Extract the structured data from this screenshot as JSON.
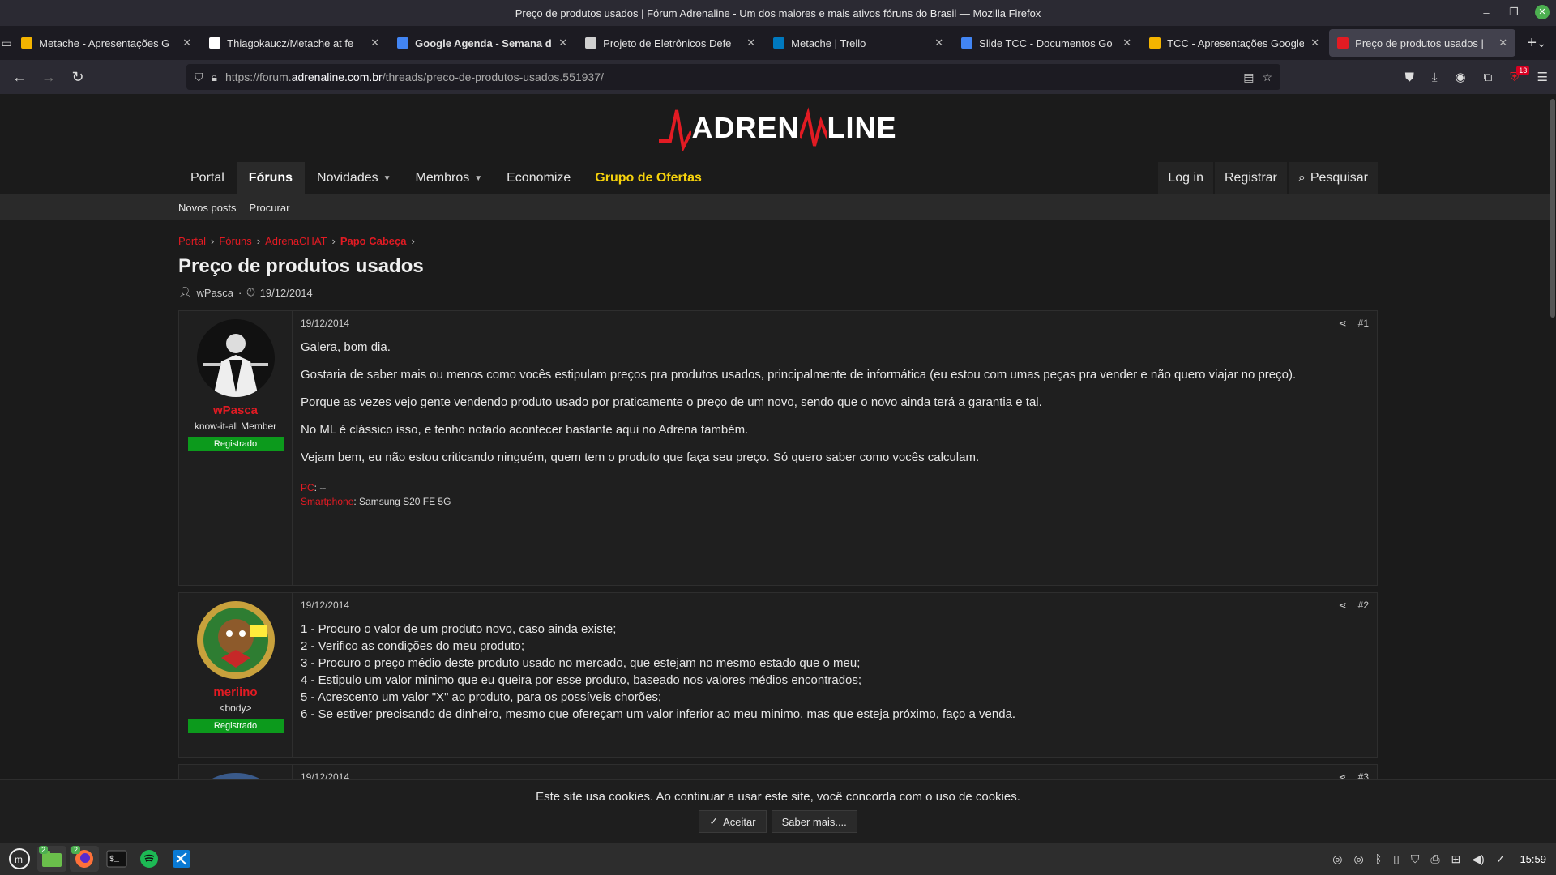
{
  "window": {
    "title": "Preço de produtos usados | Fórum Adrenaline - Um dos maiores e mais ativos fóruns do Brasil — Mozilla Firefox"
  },
  "tabs": [
    {
      "label": "Metache - Apresentações G",
      "color": "#f4b400"
    },
    {
      "label": "Thiagokaucz/Metache at fe",
      "color": "#ffffff"
    },
    {
      "label": "Google Agenda - Semana d",
      "color": "#4285f4",
      "bold": true
    },
    {
      "label": "Projeto de Eletrônicos Defe",
      "color": "#d0d0d0"
    },
    {
      "label": "Metache | Trello",
      "color": "#0079bf"
    },
    {
      "label": "Slide TCC - Documentos Go",
      "color": "#4285f4"
    },
    {
      "label": "TCC - Apresentações Google",
      "color": "#f4b400"
    },
    {
      "label": "Preço de produtos usados |",
      "color": "#e21b23",
      "active": true
    }
  ],
  "urlbar": {
    "prefix": "https://forum.",
    "domain": "adrenaline.com.br",
    "path": "/threads/preco-de-produtos-usados.551937/"
  },
  "extension_badge": "13",
  "site": {
    "logo_a": "ADREN",
    "logo_b": "LINE",
    "brand_color": "#e21b23",
    "nav": [
      {
        "label": "Portal"
      },
      {
        "label": "Fóruns",
        "active": true
      },
      {
        "label": "Novidades",
        "caret": true
      },
      {
        "label": "Membros",
        "caret": true
      },
      {
        "label": "Economize"
      },
      {
        "label": "Grupo de Ofertas",
        "highlight": true
      }
    ],
    "login": "Log in",
    "register": "Registrar",
    "search": "Pesquisar",
    "subnav": [
      "Novos posts",
      "Procurar"
    ]
  },
  "breadcrumb": [
    "Portal",
    "Fóruns",
    "AdrenaCHAT",
    "Papo Cabeça"
  ],
  "thread": {
    "title": "Preço de produtos usados",
    "author": "wPasca",
    "date": "19/12/2014"
  },
  "posts": [
    {
      "date": "19/12/2014",
      "number": "#1",
      "user": {
        "name": "wPasca",
        "title": "know-it-all Member",
        "banner": "Registrado"
      },
      "paragraphs": [
        "Galera, bom dia.",
        "Gostaria de saber mais ou menos como vocês estipulam preços pra produtos usados, principalmente de informática (eu estou com umas peças pra vender e não quero viajar no preço).",
        "Porque as vezes vejo gente vendendo produto usado por praticamente o preço de um novo, sendo que o novo ainda terá a garantia e tal.",
        "No ML é clássico isso, e tenho notado acontecer bastante aqui no Adrena também.",
        "Vejam bem, eu não estou criticando ninguém, quem tem o produto que faça seu preço. Só quero saber como vocês calculam."
      ],
      "signature": [
        {
          "key": "PC",
          "value": ": --"
        },
        {
          "key": "Smartphone",
          "value": ": Samsung S20 FE 5G"
        }
      ]
    },
    {
      "date": "19/12/2014",
      "number": "#2",
      "user": {
        "name": "meriino",
        "title": "<body>",
        "banner": "Registrado"
      },
      "lines": [
        "1 - Procuro o valor de um produto novo, caso ainda existe;",
        "2 - Verifico as condições do meu produto;",
        "3 - Procuro o preço médio deste produto usado no mercado, que estejam no mesmo estado que o meu;",
        "4 - Estipulo um valor minimo que eu queira por esse produto, baseado nos valores médios encontrados;",
        "5 - Acrescento um valor \"X\" ao produto, para os possíveis chorões;",
        "6 - Se estiver precisando de dinheiro, mesmo que ofereçam um valor inferior ao meu minimo, mas que esteja próximo, faço a venda."
      ]
    },
    {
      "date": "19/12/2014",
      "number": "#3"
    }
  ],
  "cookie": {
    "message": "Este site usa cookies. Ao continuar a usar este site, você concorda com o uso de cookies.",
    "accept": "Aceitar",
    "learn_more": "Saber mais...."
  },
  "taskbar": {
    "clock": "15:59",
    "files_count": "2",
    "firefox_count": "2"
  }
}
